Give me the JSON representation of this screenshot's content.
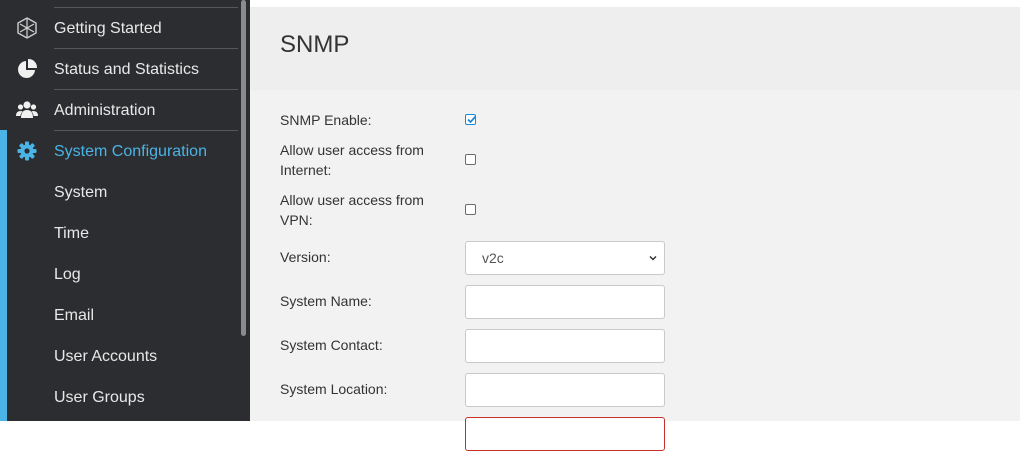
{
  "sidebar": {
    "items": [
      {
        "label": "Getting Started",
        "icon": "globe-icon"
      },
      {
        "label": "Status and Statistics",
        "icon": "pie-chart-icon"
      },
      {
        "label": "Administration",
        "icon": "users-icon"
      },
      {
        "label": "System Configuration",
        "icon": "gear-icon"
      }
    ],
    "subitems": [
      "System",
      "Time",
      "Log",
      "Email",
      "User Accounts",
      "User Groups"
    ]
  },
  "page": {
    "title": "SNMP",
    "snmp_enable_label": "SNMP Enable:",
    "internet_access_label": "Allow user access from Internet:",
    "vpn_access_label": "Allow user access from VPN:",
    "version_label": "Version:",
    "version_value": "v2c",
    "system_name_label": "System Name:",
    "system_name_value": "",
    "system_contact_label": "System Contact:",
    "system_contact_value": "",
    "system_location_label": "System Location:",
    "system_location_value": "",
    "snmp_enable_checked": true,
    "internet_access_checked": false,
    "vpn_access_checked": false
  },
  "colors": {
    "accent": "#4bb4e6",
    "sidebar_bg": "#2c2d30",
    "error_border": "#c9302c"
  }
}
